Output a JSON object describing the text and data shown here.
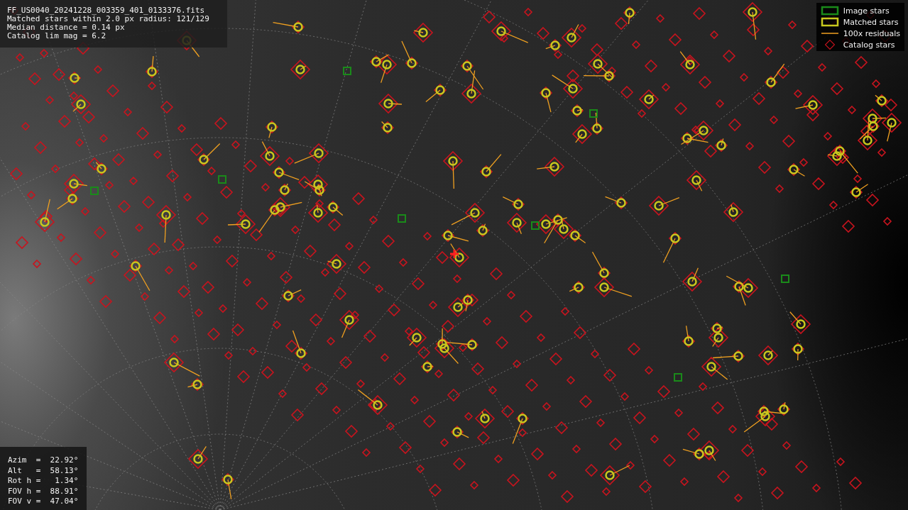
{
  "info_box": {
    "lines": [
      "FF_US0040_20241228_003359_401_0133376.fits",
      "Matched stars within 2.0 px radius: 121/129",
      "Median distance = 0.14 px",
      "Catalog lim mag = 6.2"
    ]
  },
  "legend": {
    "items": [
      {
        "kind": "image",
        "label": "Image stars"
      },
      {
        "kind": "matched",
        "label": "Matched stars"
      },
      {
        "kind": "residual",
        "label": "100x residuals"
      },
      {
        "kind": "catalog",
        "label": "Catalog stars"
      }
    ]
  },
  "pointing_box": {
    "lines": [
      "Azim  =  22.92°",
      "Alt   =  58.13°",
      "Rot h =   1.34°",
      "FOV h =  88.91°",
      "FOV v =  47.04°"
    ]
  }
}
